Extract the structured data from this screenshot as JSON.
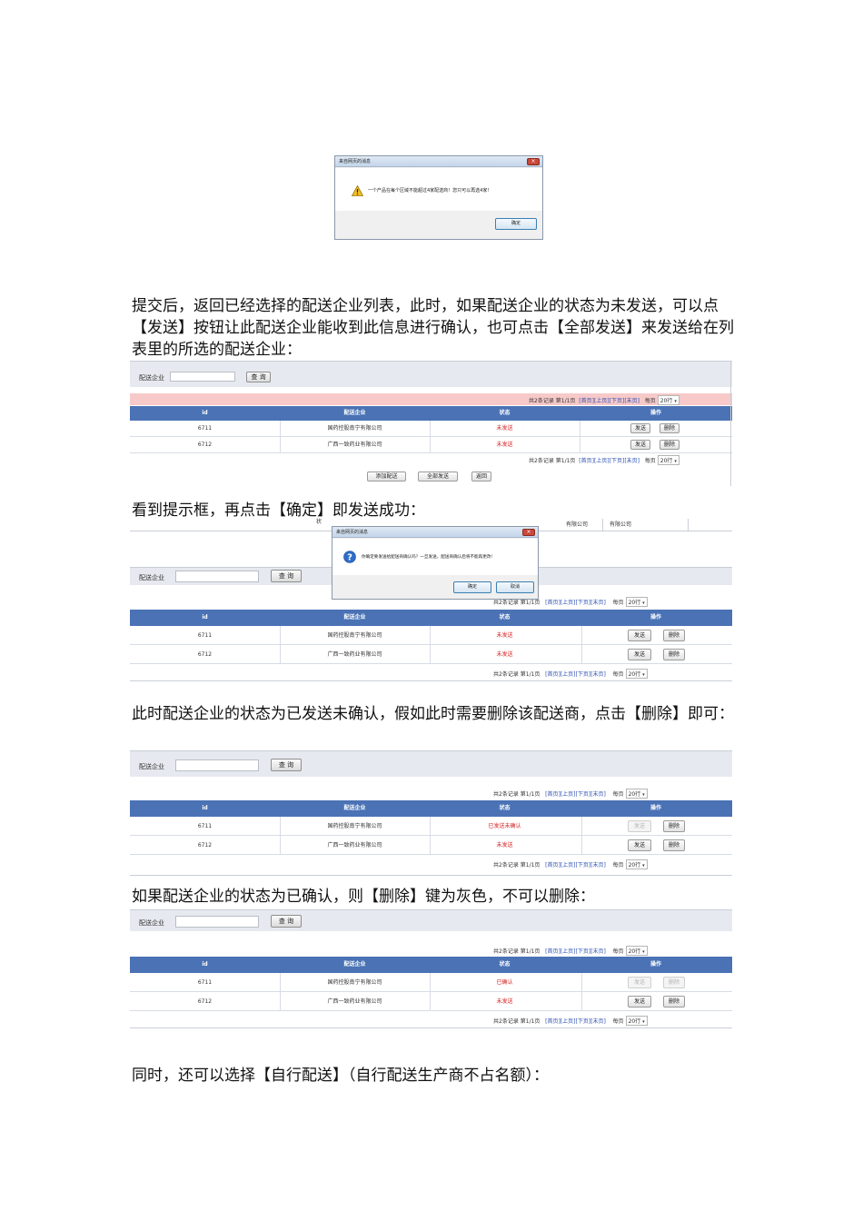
{
  "dialog1": {
    "title": "来自网页的消息",
    "close": "×",
    "icon": "warning-icon",
    "message": "一个产品在每个区域不能超过4家配送商！您只可以再选4家!",
    "ok": "确定"
  },
  "para1": "提交后，返回已经选择的配送企业列表，此时，如果配送企业的状态为未发送，可以点【发送】按钮让此配送企业能收到此信息进行确认，也可点击【全部发送】来发送给在列表里的所选的配送企业：",
  "para2": "看到提示框，再点击【确定】即发送成功：",
  "para3": "此时配送企业的状态为已发送未确认，假如此时需要删除该配送商，点击【删除】即可：",
  "para4": "如果配送企业的状态为已确认，则【删除】键为灰色，不可以删除：",
  "para5": "同时，还可以选择【自行配送】（自行配送生产商不占名额）：",
  "common": {
    "search_label": "配送企业",
    "search_button": "查 询",
    "pager_total": "共2条记录",
    "pager_page": "第1/1页",
    "pager_first": "[首页]",
    "pager_prev": "[上页]",
    "pager_next": "[下页]",
    "pager_last": "[末页]",
    "per_page_label": "每页",
    "per_page_value": "20行",
    "col_id": "id",
    "col_company": "配送企业",
    "col_status": "状态",
    "col_action": "操作",
    "send": "发送",
    "delete": "删除",
    "dropdown_arrow": "▾"
  },
  "rows": [
    {
      "id": "6711",
      "company": "国药控股南宁有限公司"
    },
    {
      "id": "6712",
      "company": "广西一致药业有限公司"
    }
  ],
  "shot1": {
    "status1": "未发送",
    "status2": "未发送",
    "add_button": "添加配送",
    "send_all_button": "全部发送",
    "back_button": "返回"
  },
  "shot2": {
    "bg_fragment_1": "有限公司",
    "bg_fragment_2": "有限公司",
    "bg_fragment_3": "状",
    "dialog_title": "来自网页的消息",
    "dialog_icon": "question-icon",
    "dialog_message": "你确定要发送给配送商确认吗？一旦发送，配送商确认后将不能再更改!",
    "dialog_ok": "确定",
    "dialog_cancel": "取消",
    "status1": "未发送",
    "status2": "未发送"
  },
  "shot3": {
    "status1": "已发送未确认",
    "status2": "未发送"
  },
  "shot4": {
    "status1": "已确认",
    "status2": "未发送"
  }
}
